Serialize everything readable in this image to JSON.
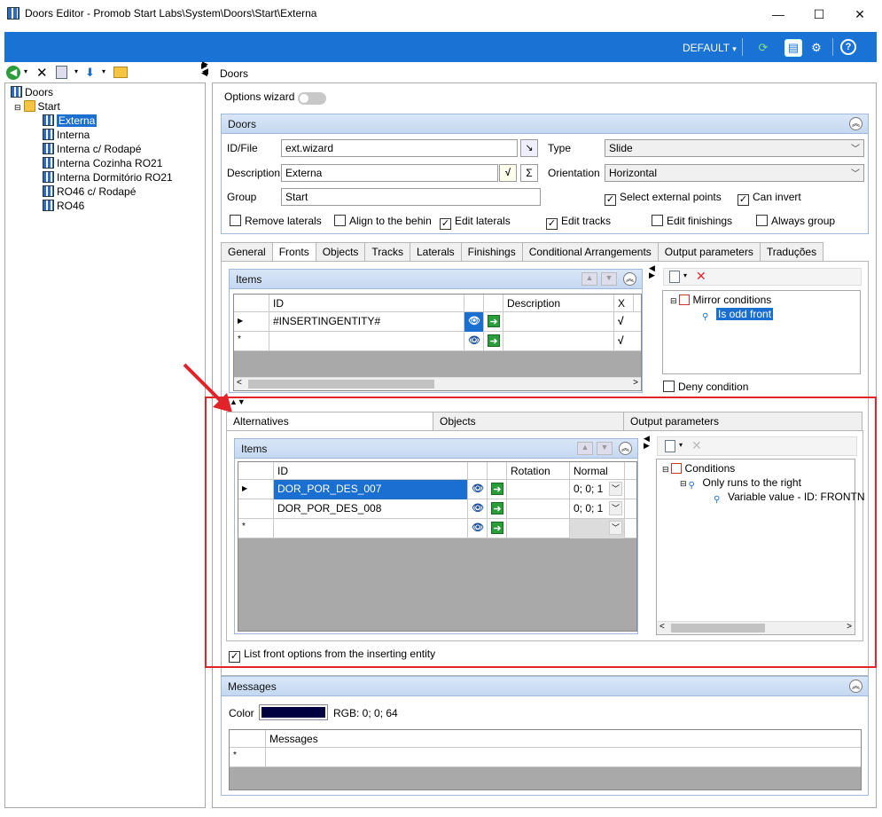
{
  "window": {
    "title": "Doors Editor - Promob Start Labs\\System\\Doors\\Start\\Externa",
    "minimize": "—",
    "maximize": "☐",
    "close": "✕"
  },
  "toolbar": {
    "profile": "DEFAULT",
    "profile_arrow": "▾"
  },
  "tree": {
    "root": "Doors",
    "folder": "Start",
    "items": [
      "Externa",
      "Interna",
      "Interna c/ Rodapé",
      "Interna Cozinha RO21",
      "Interna Dormitório RO21",
      "RO46 c/ Rodapé",
      "RO46"
    ],
    "selected": "Externa"
  },
  "breadcrumb": "Doors",
  "options_wizard": "Options wizard",
  "doors_group": {
    "title": "Doors",
    "id_label": "ID/File",
    "id_value": "ext.wizard",
    "description_label": "Description",
    "description_value": "Externa",
    "group_label": "Group",
    "group_value": "Start",
    "type_label": "Type",
    "type_value": "Slide",
    "orientation_label": "Orientation",
    "orientation_value": "Horizontal",
    "select_external_points": "Select external points",
    "can_invert": "Can invert",
    "checks": [
      {
        "label": "Remove laterals",
        "checked": false
      },
      {
        "label": "Align to the behin",
        "checked": false
      },
      {
        "label": "Edit laterals",
        "checked": true
      },
      {
        "label": "Edit tracks",
        "checked": true
      },
      {
        "label": "Edit finishings",
        "checked": false
      },
      {
        "label": "Always group",
        "checked": false
      }
    ]
  },
  "main_tabs": [
    "General",
    "Fronts",
    "Objects",
    "Tracks",
    "Laterals",
    "Finishings",
    "Conditional Arrangements",
    "Output parameters",
    "Traduções"
  ],
  "fronts": {
    "items_title": "Items",
    "columns": [
      "ID",
      "Description",
      "X"
    ],
    "rows": [
      {
        "id": "#INSERTINGENTITY#"
      }
    ],
    "mirror_conditions": "Mirror conditions",
    "is_odd_front": "Is odd front",
    "deny_condition": "Deny condition"
  },
  "sub_tabs": [
    "Alternatives",
    "Objects",
    "Output parameters"
  ],
  "alternatives": {
    "items_title": "Items",
    "columns": [
      "ID",
      "Rotation",
      "Normal"
    ],
    "rows": [
      {
        "id": "DOR_POR_DES_007",
        "normal": "0; 0; 1"
      },
      {
        "id": "DOR_POR_DES_008",
        "normal": "0; 0; 1"
      }
    ],
    "conditions": "Conditions",
    "only_runs_right": "Only runs to the right",
    "variable_value": "Variable value - ID: FRONTN",
    "list_front_options": "List front options from the inserting entity"
  },
  "messages": {
    "title": "Messages",
    "color_label": "Color",
    "color_swatch": "#000040",
    "rgb_text": "RGB: 0; 0; 64",
    "column": "Messages"
  }
}
